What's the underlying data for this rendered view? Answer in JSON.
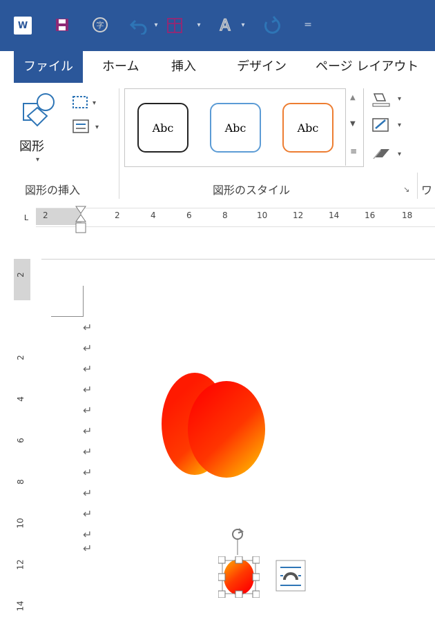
{
  "tabs": [
    "ファイル",
    "ホーム",
    "挿入",
    "デザイン",
    "ページ レイアウト"
  ],
  "ribbon": {
    "shape_label": "図形",
    "insert_group_label": "図形の挿入",
    "style_group_label": "図形のスタイル",
    "partial_label": "ワ",
    "styles": [
      "Abc",
      "Abc",
      "Abc"
    ]
  },
  "ruler": {
    "marker": "L",
    "ticks": [
      "2",
      "2",
      "4",
      "6",
      "8",
      "10",
      "12",
      "14",
      "16",
      "18"
    ]
  },
  "vertical_ruler": [
    "2",
    "2",
    "4",
    "6",
    "8",
    "10",
    "12",
    "14"
  ],
  "paragraph_mark": "↵",
  "colors": {
    "accent": "#2b579a",
    "style1": "#222222",
    "style2": "#5b9bd5",
    "style3": "#ed7d31"
  }
}
